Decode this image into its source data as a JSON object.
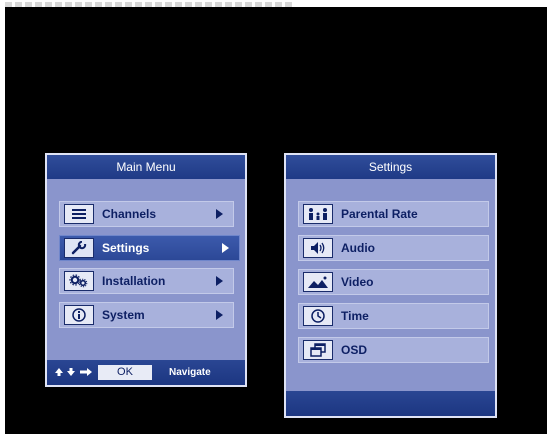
{
  "main_menu": {
    "title": "Main Menu",
    "items": [
      {
        "label": "Channels",
        "icon": "list-icon"
      },
      {
        "label": "Settings",
        "icon": "wrench-icon",
        "selected": true
      },
      {
        "label": "Installation",
        "icon": "gears-icon"
      },
      {
        "label": "System",
        "icon": "info-icon"
      }
    ],
    "footer": {
      "ok_label": "OK",
      "navigate_label": "Navigate"
    }
  },
  "settings_menu": {
    "title": "Settings",
    "items": [
      {
        "label": "Parental Rate",
        "icon": "family-icon"
      },
      {
        "label": "Audio",
        "icon": "speaker-icon"
      },
      {
        "label": "Video",
        "icon": "picture-icon"
      },
      {
        "label": "Time",
        "icon": "clock-icon"
      },
      {
        "label": "OSD",
        "icon": "windows-icon"
      }
    ]
  },
  "colors": {
    "screen": "#000000",
    "panel": "#8a95cc",
    "header": "#2a4693",
    "selected": "#3450a2"
  }
}
